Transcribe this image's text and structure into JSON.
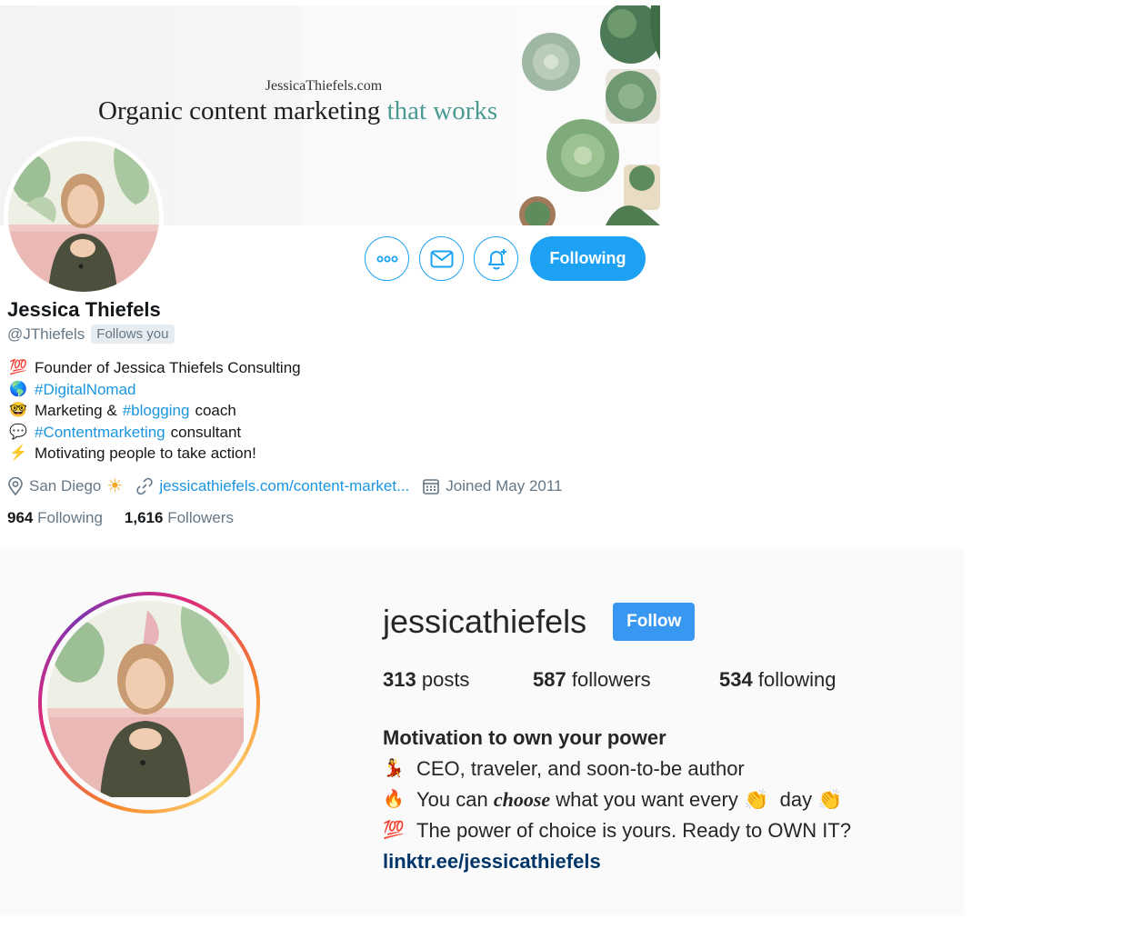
{
  "twitter": {
    "banner": {
      "url_text": "JessicaThiefels.com",
      "tagline_main": "Organic content marketing",
      "tagline_accent": "that works"
    },
    "name": "Jessica Thiefels",
    "handle": "@JThiefels",
    "follows_you": "Follows you",
    "following_button": "Following",
    "bio": {
      "l1_emoji": "💯",
      "l1_text": "Founder of Jessica Thiefels Consulting",
      "l2_emoji": "🌎",
      "l2_link": "#DigitalNomad",
      "l3_emoji": "🤓",
      "l3_pre": "Marketing &",
      "l3_link": "#blogging",
      "l3_post": "coach",
      "l4_emoji": "💬",
      "l4_link": "#Contentmarketing",
      "l4_post": "consultant",
      "l5_emoji": "⚡",
      "l5_text": "Motivating people to take action!"
    },
    "location": "San Diego",
    "location_emoji": "☀",
    "website": "jessicathiefels.com/content-market...",
    "joined": "Joined May 2011",
    "following_count": "964",
    "following_label": "Following",
    "followers_count": "1,616",
    "followers_label": "Followers",
    "accent_color": "#1da1f2"
  },
  "instagram": {
    "username": "jessicathiefels",
    "follow_button": "Follow",
    "posts_count": "313",
    "posts_label": "posts",
    "followers_count": "587",
    "followers_label": "followers",
    "following_count": "534",
    "following_label": "following",
    "bio": {
      "title": "Motivation to own your power",
      "l1_emoji": "💃",
      "l1_text": "CEO, traveler, and soon-to-be author",
      "l2_emoji": "🔥",
      "l2_pre": "You can",
      "l2_em": "choose",
      "l2_mid": "what you want every",
      "l2_clap": "👏",
      "l2_post": "day",
      "l3_emoji": "💯",
      "l3_text": "The power of choice is yours. Ready to OWN IT?",
      "link": "linktr.ee/jessicathiefels"
    },
    "accent_color": "#3897f0"
  }
}
